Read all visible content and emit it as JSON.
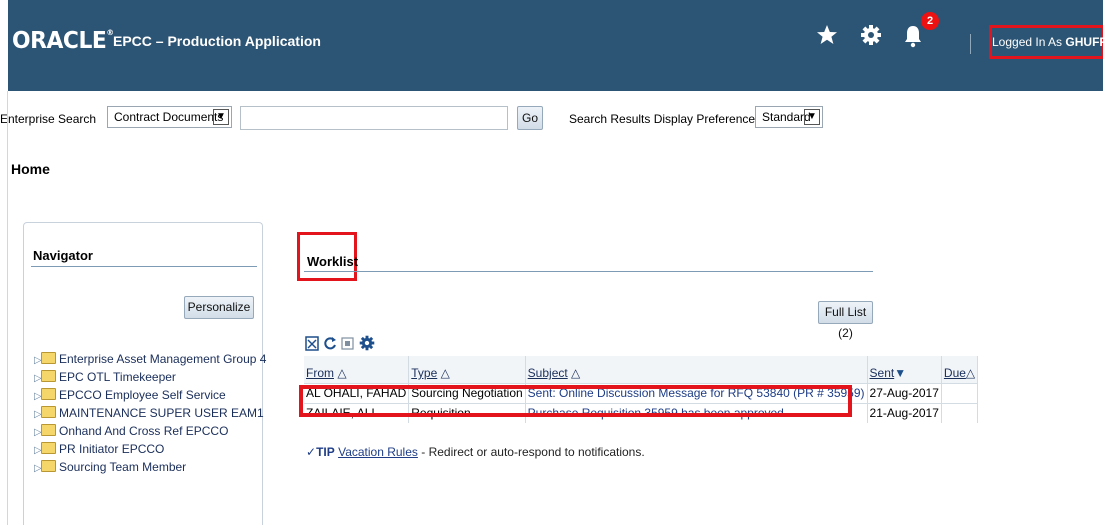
{
  "header": {
    "brand": "ORACLE",
    "brand_mark": "®",
    "app_title": "EPCC – Production Application",
    "notification_count": "2",
    "logged_in_prefix": "Logged In As ",
    "logged_in_user": "GHUFRAN",
    "highlight_color": "#e3141c",
    "bar_color": "#2c5474",
    "icons": [
      "star-icon",
      "gear-icon",
      "bell-icon"
    ]
  },
  "search": {
    "label": "Enterprise Search",
    "category": "Contract Documents",
    "query_value": "",
    "go_label": "Go",
    "pref_label": "Search Results Display Preference",
    "pref_value": "Standard"
  },
  "page": {
    "title": "Home"
  },
  "navigator": {
    "title": "Navigator",
    "personalize_label": "Personalize",
    "items": [
      {
        "label": "Enterprise Asset Management Group 4"
      },
      {
        "label": "EPC OTL Timekeeper"
      },
      {
        "label": "EPCCO Employee Self Service"
      },
      {
        "label": "MAINTENANCE SUPER USER EAM1"
      },
      {
        "label": "Onhand And Cross Ref EPCCO"
      },
      {
        "label": "PR Initiator EPCCO"
      },
      {
        "label": "Sourcing Team Member"
      }
    ]
  },
  "worklist": {
    "title": "Worklist",
    "full_list_label": "Full List (2)",
    "columns": {
      "from": "From",
      "type": "Type",
      "subject": "Subject",
      "sent": "Sent",
      "due": "Due"
    },
    "sort_icons": {
      "asc": "△",
      "desc": "▼"
    },
    "rows": [
      {
        "from": "AL OHALI, FAHAD",
        "type": "Sourcing Negotiation",
        "subject": "Sent: Online Discussion Message for RFQ 53840 (PR # 35959)",
        "sent": "27-Aug-2017",
        "due": ""
      },
      {
        "from": "ZAILAIE, ALI",
        "type": "Requisition",
        "subject": "Purchase Requisition 35959 has been approved",
        "sent": "21-Aug-2017",
        "due": ""
      }
    ],
    "tip": {
      "tip_label": "TIP",
      "link_label": "Vacation Rules",
      "text": " - Redirect or auto-respond to notifications."
    }
  }
}
